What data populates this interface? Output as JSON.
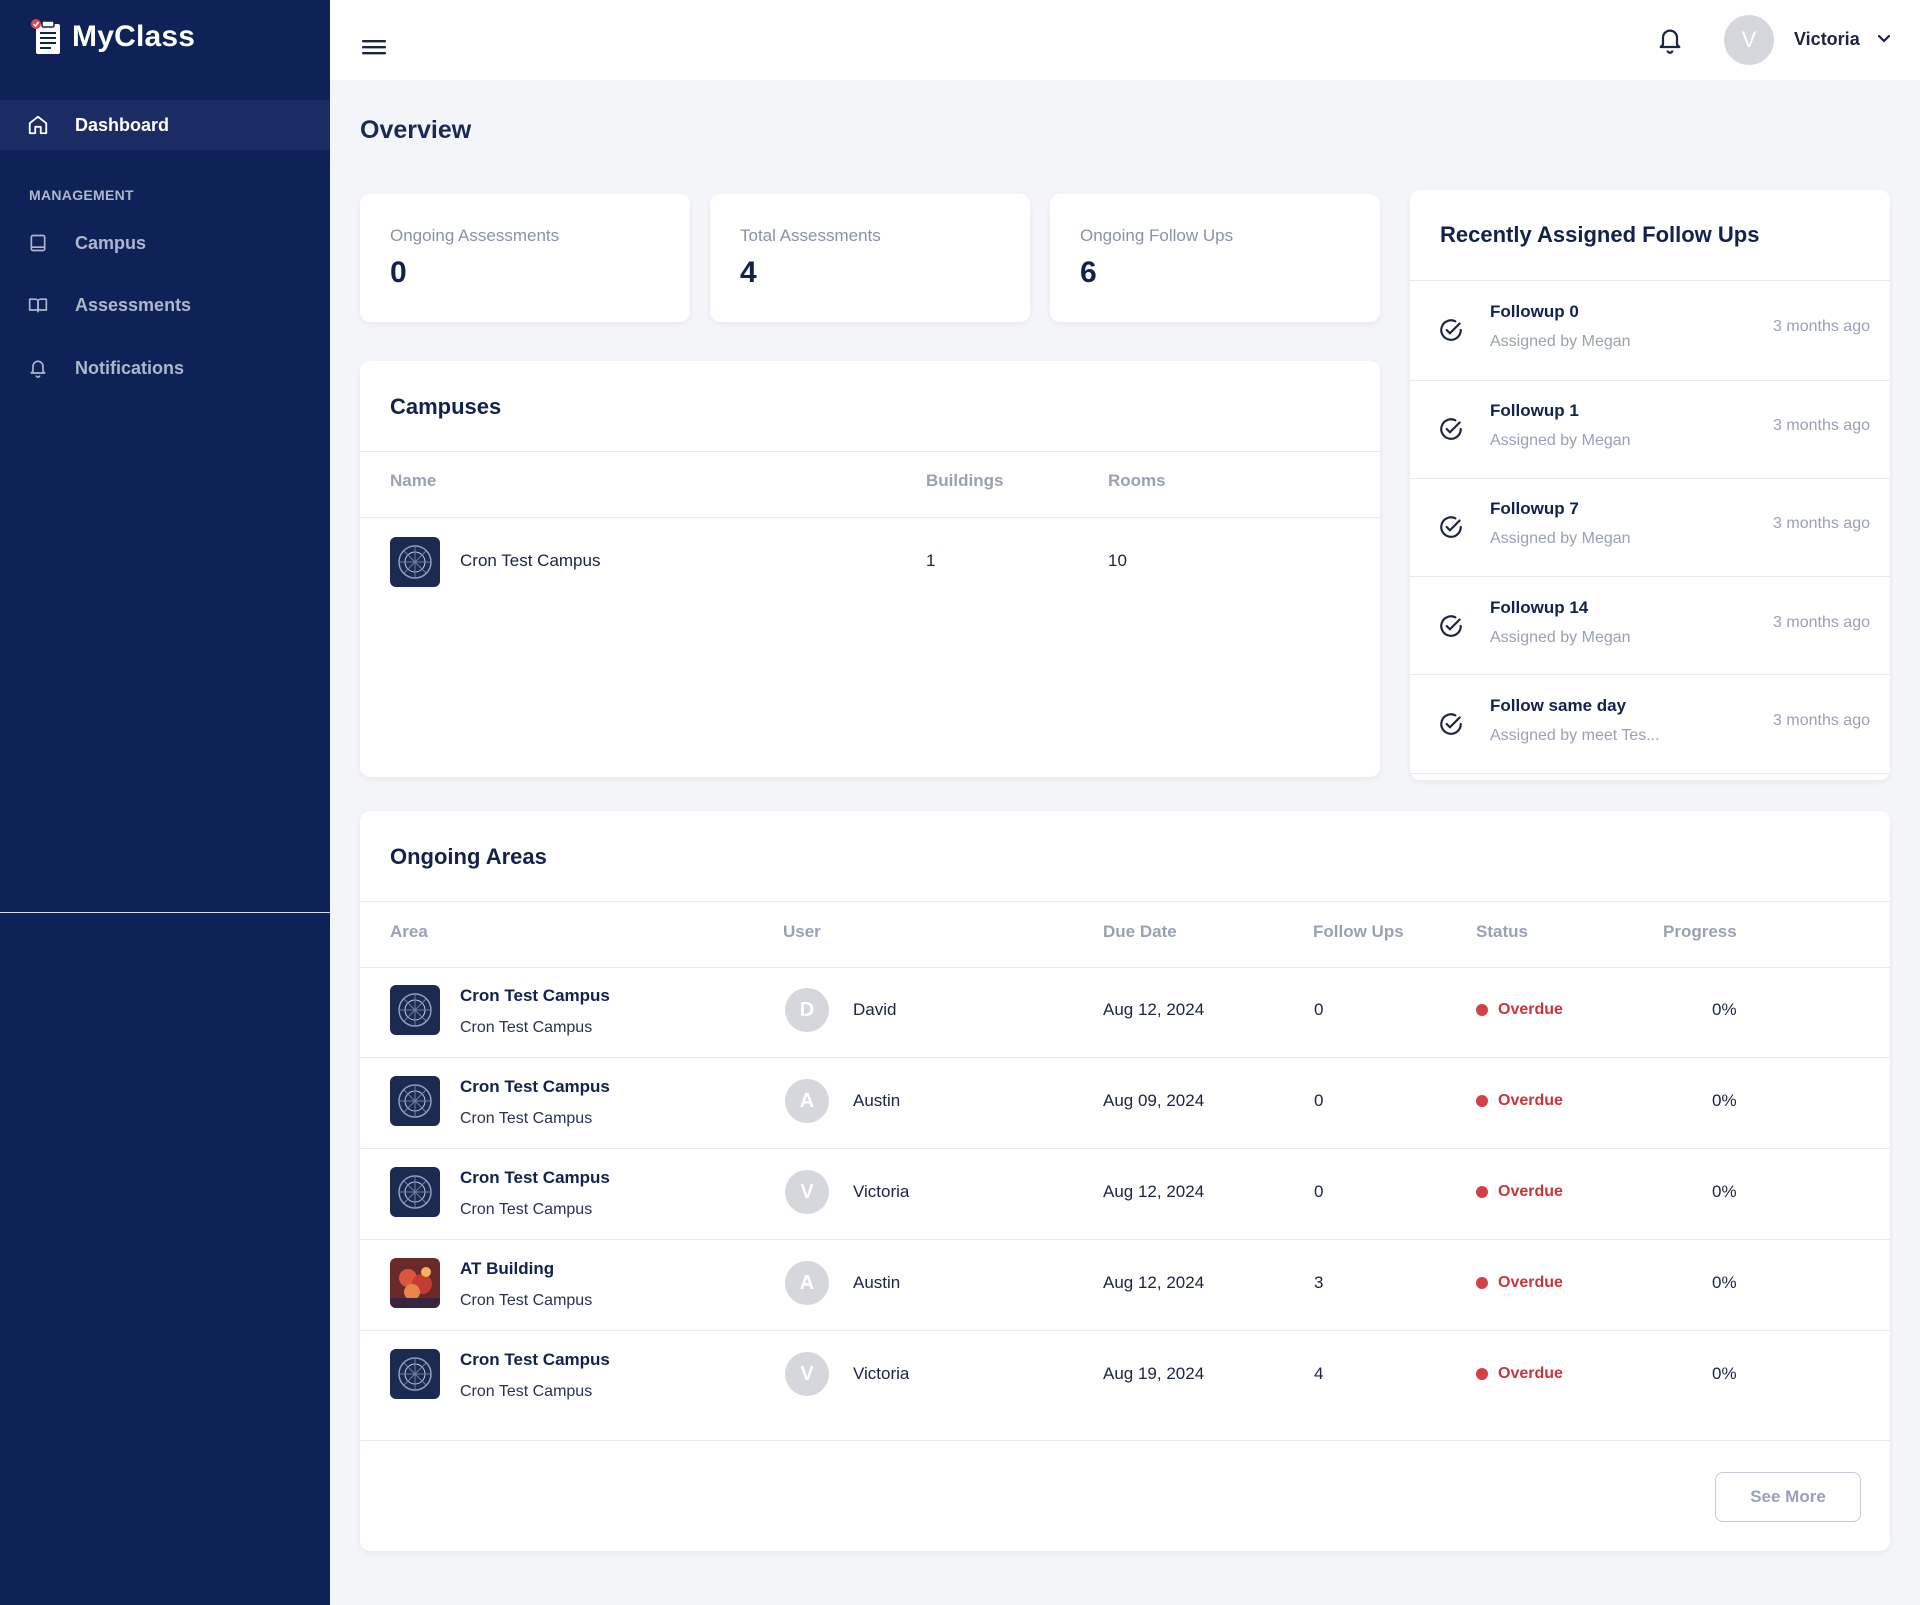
{
  "app": {
    "name": "MyClass"
  },
  "sidebar": {
    "active_item": {
      "label": "Dashboard",
      "icon": "home-icon"
    },
    "section_label": "MANAGEMENT",
    "items": [
      {
        "label": "Campus",
        "icon": "tablet-icon"
      },
      {
        "label": "Assessments",
        "icon": "book-icon"
      },
      {
        "label": "Notifications",
        "icon": "bell-icon"
      }
    ]
  },
  "header": {
    "user_initial": "V",
    "user_name": "Victoria"
  },
  "page": {
    "title": "Overview"
  },
  "stats": [
    {
      "label": "Ongoing Assessments",
      "value": "0"
    },
    {
      "label": "Total Assessments",
      "value": "4"
    },
    {
      "label": "Ongoing Follow Ups",
      "value": "6"
    }
  ],
  "campuses": {
    "title": "Campuses",
    "columns": [
      "Name",
      "Buildings",
      "Rooms"
    ],
    "rows": [
      {
        "name": "Cron Test Campus",
        "buildings": "1",
        "rooms": "10"
      }
    ]
  },
  "followups": {
    "title": "Recently Assigned Follow Ups",
    "items": [
      {
        "title": "Followup 0",
        "sub": "Assigned by Megan",
        "time": "3 months ago"
      },
      {
        "title": "Followup 1",
        "sub": "Assigned by Megan",
        "time": "3 months ago"
      },
      {
        "title": "Followup 7",
        "sub": "Assigned by Megan",
        "time": "3 months ago"
      },
      {
        "title": "Followup 14",
        "sub": "Assigned by Megan",
        "time": "3 months ago"
      },
      {
        "title": "Follow same day",
        "sub": "Assigned by meet Tes...",
        "time": "3 months ago"
      }
    ]
  },
  "areas": {
    "title": "Ongoing Areas",
    "columns": [
      "Area",
      "User",
      "Due Date",
      "Follow Ups",
      "Status",
      "Progress"
    ],
    "rows": [
      {
        "area": "Cron Test Campus",
        "campus": "Cron Test Campus",
        "initial": "D",
        "user": "David",
        "due": "Aug 12, 2024",
        "followups": "0",
        "status": "Overdue",
        "progress": "0%",
        "thumb": "campus"
      },
      {
        "area": "Cron Test Campus",
        "campus": "Cron Test Campus",
        "initial": "A",
        "user": "Austin",
        "due": "Aug 09, 2024",
        "followups": "0",
        "status": "Overdue",
        "progress": "0%",
        "thumb": "campus"
      },
      {
        "area": "Cron Test Campus",
        "campus": "Cron Test Campus",
        "initial": "V",
        "user": "Victoria",
        "due": "Aug 12, 2024",
        "followups": "0",
        "status": "Overdue",
        "progress": "0%",
        "thumb": "campus"
      },
      {
        "area": "AT Building",
        "campus": "Cron Test Campus",
        "initial": "A",
        "user": "Austin",
        "due": "Aug 12, 2024",
        "followups": "3",
        "status": "Overdue",
        "progress": "0%",
        "thumb": "building"
      },
      {
        "area": "Cron Test Campus",
        "campus": "Cron Test Campus",
        "initial": "V",
        "user": "Victoria",
        "due": "Aug 19, 2024",
        "followups": "4",
        "status": "Overdue",
        "progress": "0%",
        "thumb": "campus"
      }
    ],
    "see_more": "See More"
  }
}
